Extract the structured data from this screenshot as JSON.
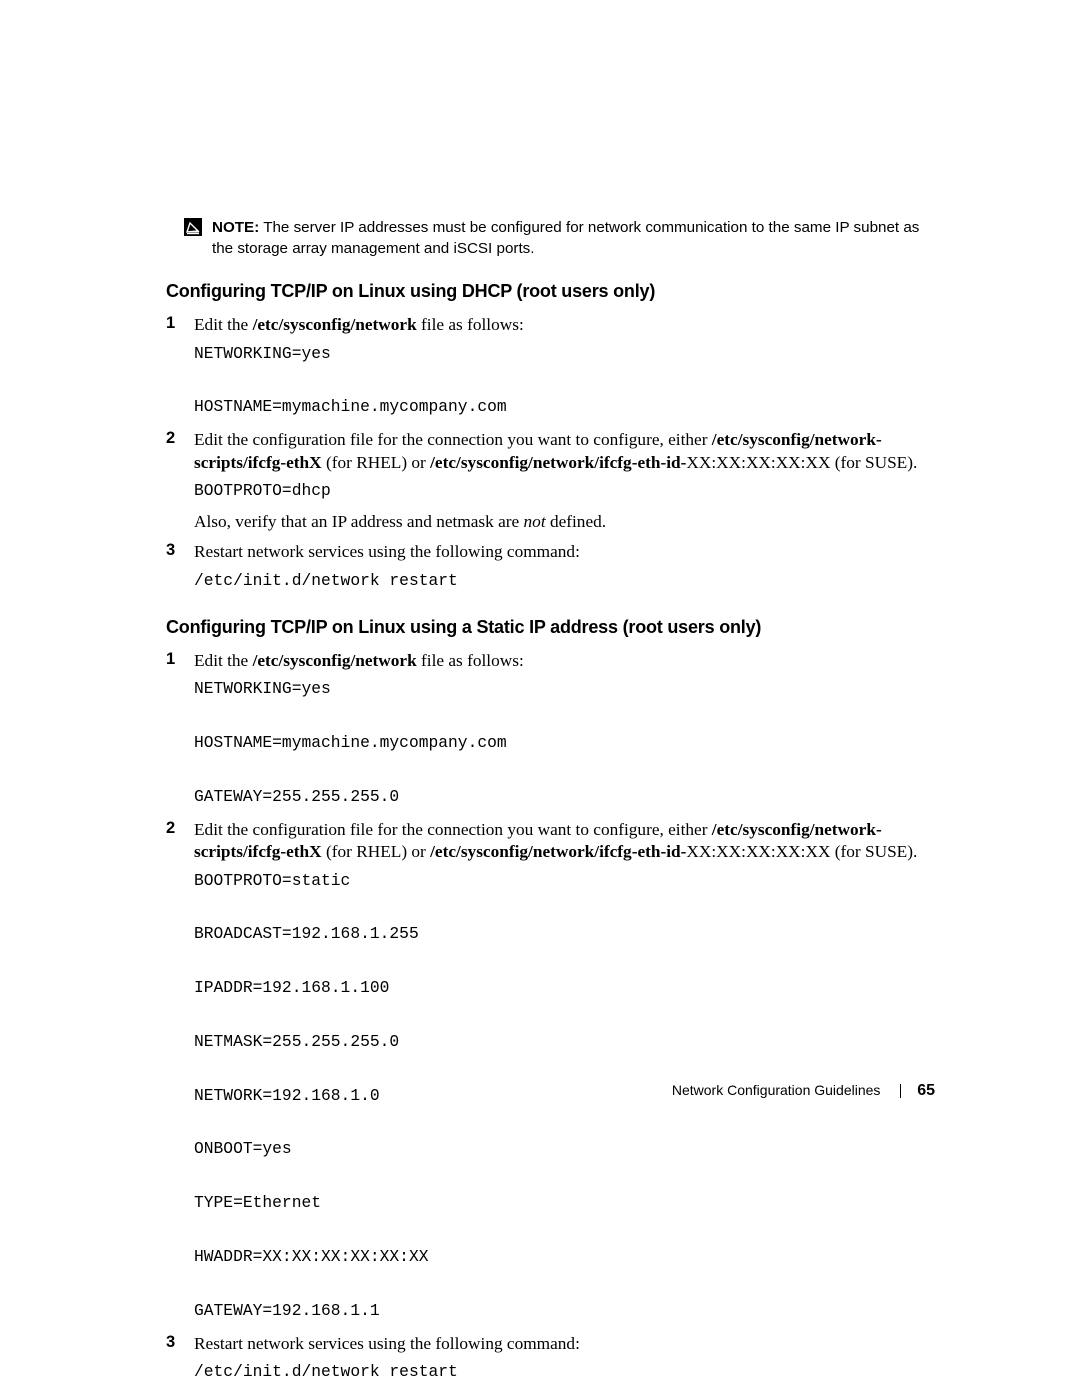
{
  "note": {
    "label": "NOTE:",
    "text": " The server IP addresses must be configured for network communication to the same IP subnet as the storage array management and iSCSI ports."
  },
  "section1": {
    "heading": "Configuring TCP/IP on Linux using DHCP (root users only)",
    "steps": [
      {
        "num": "1",
        "lead": "Edit the ",
        "path": "/etc/sysconfig/network",
        "trail": " file as follows:",
        "code": "NETWORKING=yes\n\nHOSTNAME=mymachine.mycompany.com"
      },
      {
        "num": "2",
        "lead": "Edit the configuration file for the connection you want to configure, either ",
        "path1": "/etc/sysconfig/network-scripts/ifcfg-ethX",
        "mid1": " (for RHEL) or ",
        "path2": "/etc/sysconfig/network/ifcfg-eth-id-",
        "trail": "XX:XX:XX:XX:XX (for SUSE).",
        "code": "BOOTPROTO=dhcp",
        "after1": "Also, verify that an IP address and netmask are ",
        "after_italic": "not",
        "after2": " defined."
      },
      {
        "num": "3",
        "lead": "Restart network services using the following command:",
        "code": "/etc/init.d/network restart"
      }
    ]
  },
  "section2": {
    "heading": "Configuring TCP/IP on Linux using a Static IP address (root users only)",
    "steps": [
      {
        "num": "1",
        "lead": "Edit the ",
        "path": "/etc/sysconfig/network",
        "trail": " file as follows:",
        "code": "NETWORKING=yes\n\nHOSTNAME=mymachine.mycompany.com\n\nGATEWAY=255.255.255.0"
      },
      {
        "num": "2",
        "lead": "Edit the configuration file for the connection you want to configure, either ",
        "path1": "/etc/sysconfig/network-scripts/ifcfg-ethX",
        "mid1": " (for RHEL) or ",
        "path2": "/etc/sysconfig/network/ifcfg-eth-id-",
        "trail": "XX:XX:XX:XX:XX (for SUSE).",
        "code": "BOOTPROTO=static\n\nBROADCAST=192.168.1.255\n\nIPADDR=192.168.1.100\n\nNETMASK=255.255.255.0\n\nNETWORK=192.168.1.0\n\nONBOOT=yes\n\nTYPE=Ethernet\n\nHWADDR=XX:XX:XX:XX:XX:XX\n\nGATEWAY=192.168.1.1"
      },
      {
        "num": "3",
        "lead": "Restart network services using the following command:",
        "code": "/etc/init.d/network restart"
      }
    ]
  },
  "footer": {
    "title": "Network Configuration Guidelines",
    "page": "65"
  }
}
